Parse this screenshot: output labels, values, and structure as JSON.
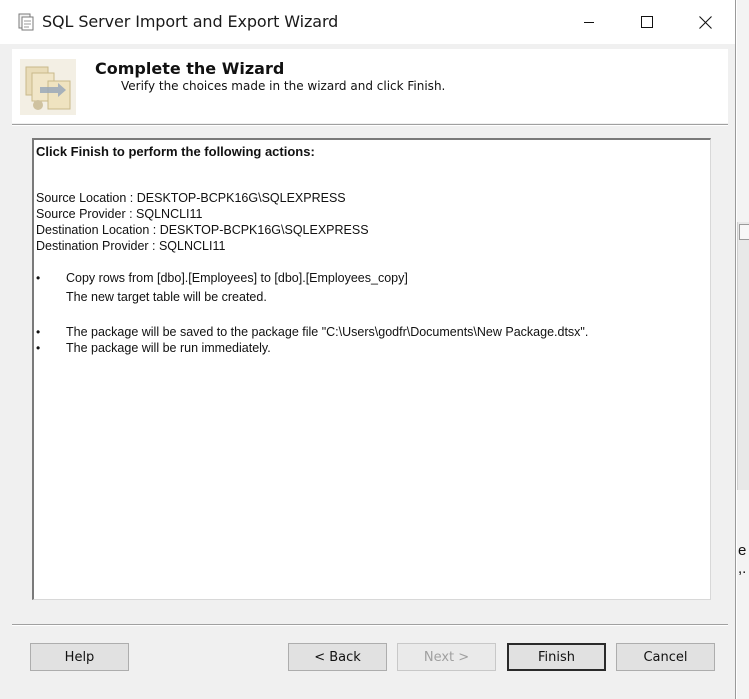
{
  "window": {
    "title": "SQL Server Import and Export Wizard",
    "controls": {
      "minimize": "minimize",
      "maximize": "maximize",
      "close": "close"
    }
  },
  "header": {
    "title": "Complete the Wizard",
    "subtitle": "Verify the choices made in the wizard and click Finish."
  },
  "summary": {
    "heading": "Click Finish to perform the following actions:",
    "lines": [
      "Source Location : DESKTOP-BCPK16G\\SQLEXPRESS",
      "Source Provider : SQLNCLI11",
      "Destination Location : DESKTOP-BCPK16G\\SQLEXPRESS",
      "Destination Provider : SQLNCLI11"
    ],
    "bullets": [
      {
        "text": "Copy rows from [dbo].[Employees] to [dbo].[Employees_copy]",
        "detail": "The new target table will be created."
      },
      {
        "text": "The package will be saved to the package file \"C:\\Users\\godfr\\Documents\\New Package.dtsx\"."
      },
      {
        "text": "The package will be run immediately."
      }
    ],
    "bullet_char": "•"
  },
  "buttons": {
    "help": "Help",
    "back": "< Back",
    "next": "Next >",
    "finish": "Finish",
    "cancel": "Cancel"
  },
  "background": {
    "text": "e t\n,."
  },
  "colors": {
    "window_bg": "#f0f0f0",
    "panel_bg": "#ffffff",
    "button_bg": "#e1e1e1"
  }
}
